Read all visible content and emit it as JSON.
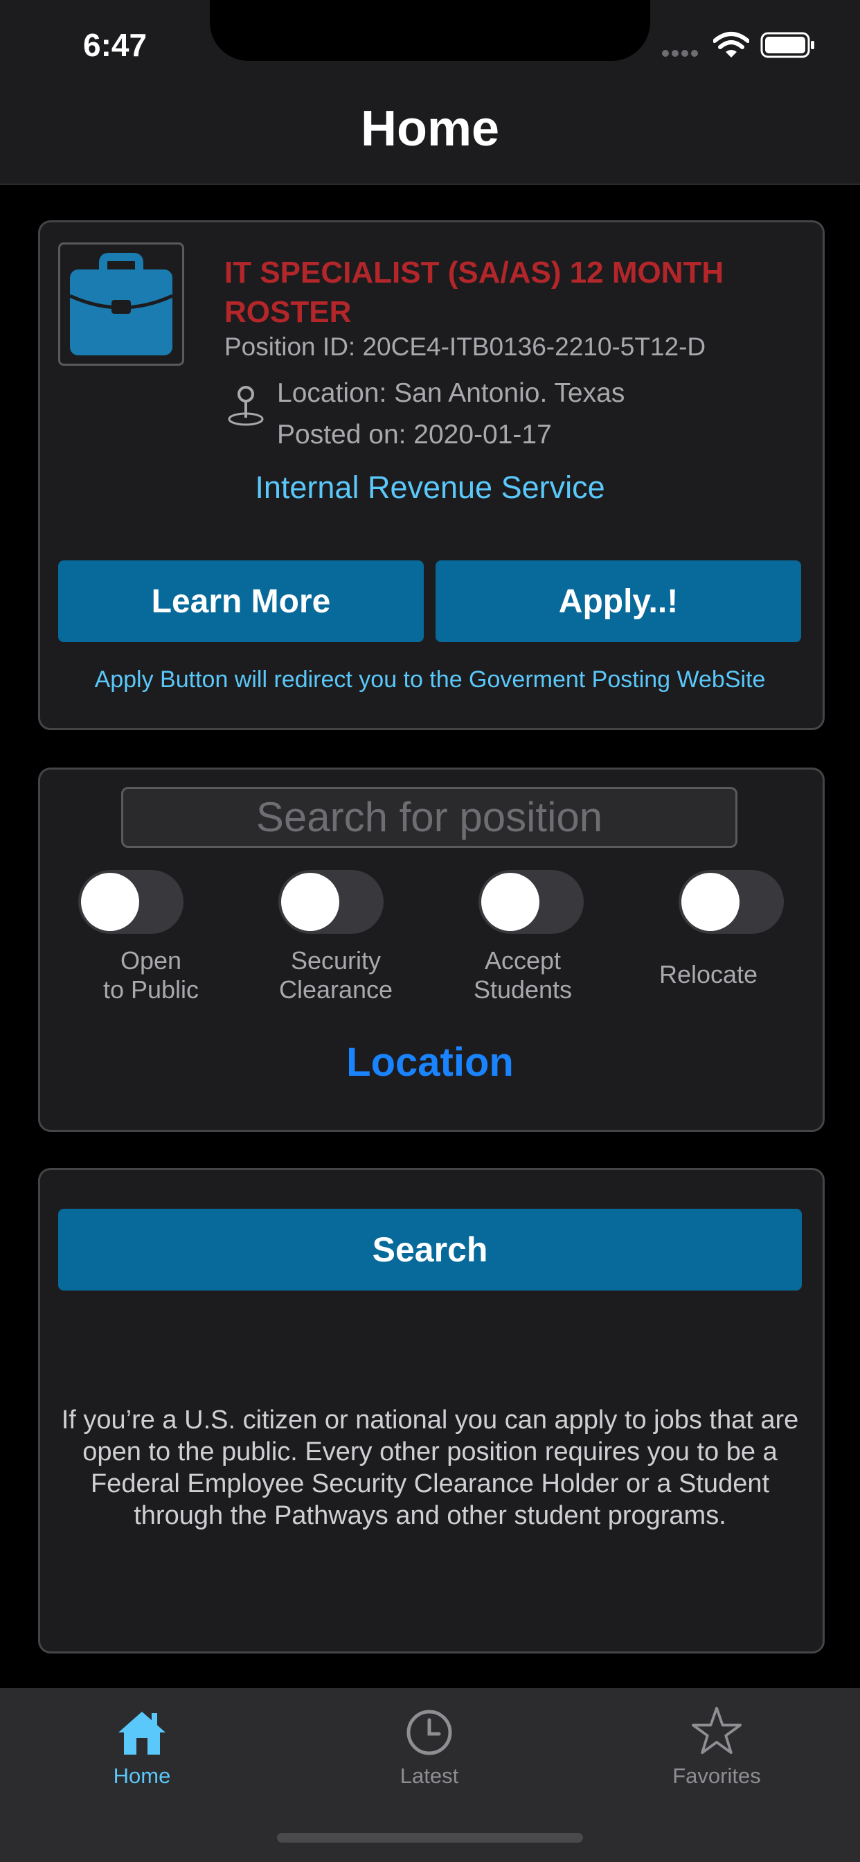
{
  "status_bar": {
    "time": "6:47"
  },
  "nav": {
    "title": "Home"
  },
  "job": {
    "title": "IT SPECIALIST (SA/AS) 12 MONTH ROSTER",
    "position_id": "Position ID: 20CE4-ITB0136-2210-5T12-D",
    "location": "Location: San Antonio. Texas",
    "posted": "Posted on: 2020-01-17",
    "agency": "Internal Revenue Service",
    "learn_more_label": "Learn More",
    "apply_label": "Apply..!",
    "apply_note": "Apply Button will redirect you to the Goverment Posting WebSite"
  },
  "filters": {
    "search_placeholder": "Search for position",
    "toggles": [
      {
        "label": "Open\nto Public",
        "on": false
      },
      {
        "label": "Security\nClearance",
        "on": false
      },
      {
        "label": "Accept\nStudents",
        "on": false
      },
      {
        "label": "Relocate",
        "on": false
      }
    ],
    "location_label": "Location"
  },
  "search": {
    "button_label": "Search",
    "info": "If you’re a U.S. citizen or national you can apply to jobs that are open to the public. Every other position requires you to be a Federal Employee Security Clearance Holder or a Student through the Pathways and other student programs."
  },
  "tabs": [
    {
      "label": "Home",
      "icon": "home-icon",
      "active": true
    },
    {
      "label": "Latest",
      "icon": "clock-icon",
      "active": false
    },
    {
      "label": "Favorites",
      "icon": "star-icon",
      "active": false
    }
  ],
  "colors": {
    "accent": "#5ac8fa",
    "button": "#086a9a",
    "job_title": "#b3262a",
    "location_link": "#1a84ff",
    "tab_inactive": "#8e8e93"
  }
}
